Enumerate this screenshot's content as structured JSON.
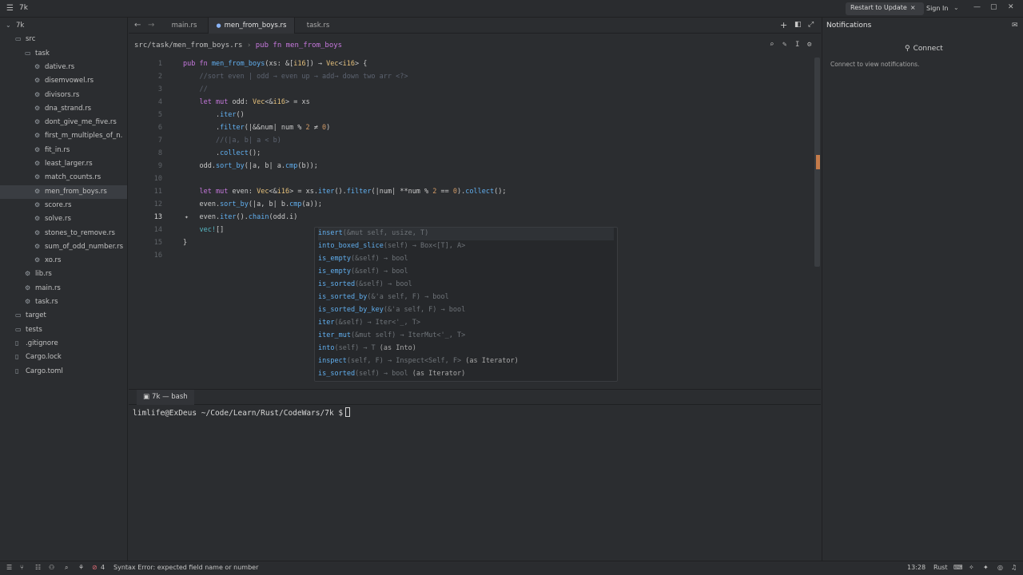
{
  "titlebar": {
    "project": "7k",
    "restart_label": "Restart to Update",
    "signin_label": "Sign In"
  },
  "sidebar": {
    "items": [
      {
        "label": "7k",
        "indent": 0,
        "icon": "chevron-down"
      },
      {
        "label": "src",
        "indent": 1,
        "icon": "folder"
      },
      {
        "label": "task",
        "indent": 2,
        "icon": "folder"
      },
      {
        "label": "dative.rs",
        "indent": 3,
        "icon": "rust-file"
      },
      {
        "label": "disemvowel.rs",
        "indent": 3,
        "icon": "rust-file"
      },
      {
        "label": "divisors.rs",
        "indent": 3,
        "icon": "rust-file"
      },
      {
        "label": "dna_strand.rs",
        "indent": 3,
        "icon": "rust-file"
      },
      {
        "label": "dont_give_me_five.rs",
        "indent": 3,
        "icon": "rust-file"
      },
      {
        "label": "first_m_multiples_of_n.",
        "indent": 3,
        "icon": "rust-file"
      },
      {
        "label": "fit_in.rs",
        "indent": 3,
        "icon": "rust-file"
      },
      {
        "label": "least_larger.rs",
        "indent": 3,
        "icon": "rust-file"
      },
      {
        "label": "match_counts.rs",
        "indent": 3,
        "icon": "rust-file"
      },
      {
        "label": "men_from_boys.rs",
        "indent": 3,
        "icon": "rust-file",
        "selected": true
      },
      {
        "label": "score.rs",
        "indent": 3,
        "icon": "rust-file"
      },
      {
        "label": "solve.rs",
        "indent": 3,
        "icon": "rust-file"
      },
      {
        "label": "stones_to_remove.rs",
        "indent": 3,
        "icon": "rust-file"
      },
      {
        "label": "sum_of_odd_number.rs",
        "indent": 3,
        "icon": "rust-file"
      },
      {
        "label": "xo.rs",
        "indent": 3,
        "icon": "rust-file"
      },
      {
        "label": "lib.rs",
        "indent": 2,
        "icon": "rust-file"
      },
      {
        "label": "main.rs",
        "indent": 2,
        "icon": "rust-file"
      },
      {
        "label": "task.rs",
        "indent": 2,
        "icon": "rust-file"
      },
      {
        "label": "target",
        "indent": 1,
        "icon": "folder"
      },
      {
        "label": "tests",
        "indent": 1,
        "icon": "folder"
      },
      {
        "label": ".gitignore",
        "indent": 1,
        "icon": "file"
      },
      {
        "label": "Cargo.lock",
        "indent": 1,
        "icon": "file"
      },
      {
        "label": "Cargo.toml",
        "indent": 1,
        "icon": "file"
      }
    ]
  },
  "tabs": [
    {
      "label": "main.rs"
    },
    {
      "label": "men_from_boys.rs",
      "active": true
    },
    {
      "label": "task.rs"
    }
  ],
  "breadcrumb": {
    "path": "src/task/men_from_boys.rs",
    "symbol": "pub fn men_from_boys"
  },
  "editor": {
    "current_line": "13",
    "lines": [
      {
        "n": "1",
        "html": "<span class='kw'>pub</span> <span class='kw'>fn</span> <span class='fn'>men_from_boys</span>(xs: &amp;[<span class='ty'>i16</span>]) → <span class='ty'>Vec</span>&lt;<span class='ty'>i16</span>&gt; {"
      },
      {
        "n": "2",
        "html": "    <span class='cm'>//sort even | odd → even up → add→ down two arr &lt;?&gt;</span>"
      },
      {
        "n": "3",
        "html": "    <span class='cm'>//</span>"
      },
      {
        "n": "4",
        "html": "    <span class='kw'>let</span> <span class='kw'>mut</span> odd: <span class='ty'>Vec</span>&lt;&amp;<span class='ty'>i16</span>&gt; = xs"
      },
      {
        "n": "5",
        "html": "        .<span class='fn'>iter</span>()"
      },
      {
        "n": "6",
        "html": "        .<span class='fn'>filter</span>(|&amp;&amp;num| num % <span class='num'>2</span> ≠ <span class='num'>0</span>)"
      },
      {
        "n": "7",
        "html": "        <span class='cm'>//(|a, b| a &lt; b)</span>"
      },
      {
        "n": "8",
        "html": "        .<span class='fn'>collect</span>();"
      },
      {
        "n": "9",
        "html": "    odd.<span class='fn'>sort_by</span>(|a, b| a.<span class='fn'>cmp</span>(b));"
      },
      {
        "n": "10",
        "html": ""
      },
      {
        "n": "11",
        "html": "    <span class='kw'>let</span> <span class='kw'>mut</span> even: <span class='ty'>Vec</span>&lt;&amp;<span class='ty'>i16</span>&gt; = xs.<span class='fn'>iter</span>().<span class='fn'>filter</span>(|num| **num % <span class='num'>2</span> == <span class='num'>0</span>).<span class='fn'>collect</span>();"
      },
      {
        "n": "12",
        "html": "    even.<span class='fn'>sort_by</span>(|a, b| b.<span class='fn'>cmp</span>(a));"
      },
      {
        "n": "13",
        "html": "    even.<span class='fn'>iter</span>().<span class='fn'>chain</span>(odd.i)"
      },
      {
        "n": "14",
        "html": "    <span class='mac'>vec!</span>[]"
      },
      {
        "n": "15",
        "html": "}"
      },
      {
        "n": "16",
        "html": ""
      }
    ]
  },
  "autocomplete": {
    "items": [
      {
        "name": "insert",
        "sig": "(&mut self, usize, T)",
        "extra": ""
      },
      {
        "name": "into_boxed_slice",
        "sig": "(self) → Box<[T], A>",
        "extra": ""
      },
      {
        "name": "is_empty",
        "sig": "(&self) → bool",
        "extra": ""
      },
      {
        "name": "is_empty",
        "sig": "(&self) → bool",
        "extra": ""
      },
      {
        "name": "is_sorted",
        "sig": "(&self) → bool",
        "extra": ""
      },
      {
        "name": "is_sorted_by",
        "sig": "(&'a self, F) → bool",
        "extra": ""
      },
      {
        "name": "is_sorted_by_key",
        "sig": "(&'a self, F) → bool",
        "extra": ""
      },
      {
        "name": "iter",
        "sig": "(&self) → Iter<'_, T>",
        "extra": ""
      },
      {
        "name": "iter_mut",
        "sig": "(&mut self) → IterMut<'_, T>",
        "extra": ""
      },
      {
        "name": "into",
        "sig": "(self) → T",
        "extra": " (as Into)"
      },
      {
        "name": "inspect",
        "sig": "(self, F) → Inspect<Self, F>",
        "extra": " (as Iterator)"
      },
      {
        "name": "is_sorted",
        "sig": "(self) → bool",
        "extra": " (as Iterator)"
      }
    ]
  },
  "terminal": {
    "tab_label": "7k — bash",
    "prompt": "limlife@ExDeus ~/Code/Learn/Rust/CodeWars/7k $"
  },
  "notifications": {
    "title": "Notifications",
    "connect_label": "Connect",
    "hint": "Connect to view notifications."
  },
  "statusbar": {
    "error_count": "4",
    "message": "Syntax Error: expected field name or number",
    "position": "13:28",
    "language": "Rust"
  },
  "colors": {
    "background": "#2b2d30",
    "keyword": "#c678dd",
    "function": "#61afef",
    "type": "#e5c07b",
    "error": "#e06c75"
  }
}
